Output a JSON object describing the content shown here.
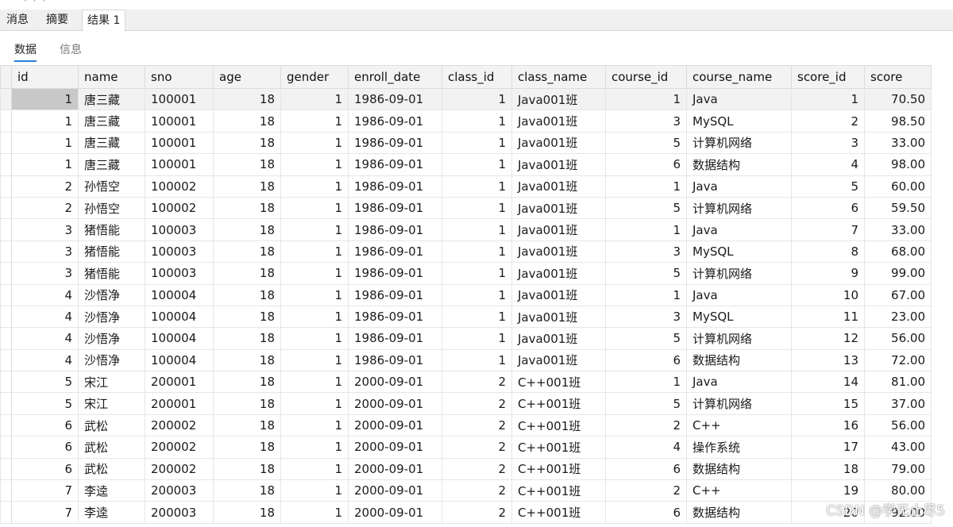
{
  "tabs": [
    "消息",
    "摘要",
    "结果 1"
  ],
  "subtabs": [
    "数据",
    "信息"
  ],
  "columns": [
    "id",
    "name",
    "sno",
    "age",
    "gender",
    "enroll_date",
    "class_id",
    "class_name",
    "course_id",
    "course_name",
    "score_id",
    "score"
  ],
  "rows": [
    [
      "1",
      "唐三藏",
      "100001",
      "18",
      "1",
      "1986-09-01",
      "1",
      "Java001班",
      "1",
      "Java",
      "1",
      "70.50"
    ],
    [
      "1",
      "唐三藏",
      "100001",
      "18",
      "1",
      "1986-09-01",
      "1",
      "Java001班",
      "3",
      "MySQL",
      "2",
      "98.50"
    ],
    [
      "1",
      "唐三藏",
      "100001",
      "18",
      "1",
      "1986-09-01",
      "1",
      "Java001班",
      "5",
      "计算机网络",
      "3",
      "33.00"
    ],
    [
      "1",
      "唐三藏",
      "100001",
      "18",
      "1",
      "1986-09-01",
      "1",
      "Java001班",
      "6",
      "数据结构",
      "4",
      "98.00"
    ],
    [
      "2",
      "孙悟空",
      "100002",
      "18",
      "1",
      "1986-09-01",
      "1",
      "Java001班",
      "1",
      "Java",
      "5",
      "60.00"
    ],
    [
      "2",
      "孙悟空",
      "100002",
      "18",
      "1",
      "1986-09-01",
      "1",
      "Java001班",
      "5",
      "计算机网络",
      "6",
      "59.50"
    ],
    [
      "3",
      "猪悟能",
      "100003",
      "18",
      "1",
      "1986-09-01",
      "1",
      "Java001班",
      "1",
      "Java",
      "7",
      "33.00"
    ],
    [
      "3",
      "猪悟能",
      "100003",
      "18",
      "1",
      "1986-09-01",
      "1",
      "Java001班",
      "3",
      "MySQL",
      "8",
      "68.00"
    ],
    [
      "3",
      "猪悟能",
      "100003",
      "18",
      "1",
      "1986-09-01",
      "1",
      "Java001班",
      "5",
      "计算机网络",
      "9",
      "99.00"
    ],
    [
      "4",
      "沙悟净",
      "100004",
      "18",
      "1",
      "1986-09-01",
      "1",
      "Java001班",
      "1",
      "Java",
      "10",
      "67.00"
    ],
    [
      "4",
      "沙悟净",
      "100004",
      "18",
      "1",
      "1986-09-01",
      "1",
      "Java001班",
      "3",
      "MySQL",
      "11",
      "23.00"
    ],
    [
      "4",
      "沙悟净",
      "100004",
      "18",
      "1",
      "1986-09-01",
      "1",
      "Java001班",
      "5",
      "计算机网络",
      "12",
      "56.00"
    ],
    [
      "4",
      "沙悟净",
      "100004",
      "18",
      "1",
      "1986-09-01",
      "1",
      "Java001班",
      "6",
      "数据结构",
      "13",
      "72.00"
    ],
    [
      "5",
      "宋江",
      "200001",
      "18",
      "1",
      "2000-09-01",
      "2",
      "C++001班",
      "1",
      "Java",
      "14",
      "81.00"
    ],
    [
      "5",
      "宋江",
      "200001",
      "18",
      "1",
      "2000-09-01",
      "2",
      "C++001班",
      "5",
      "计算机网络",
      "15",
      "37.00"
    ],
    [
      "6",
      "武松",
      "200002",
      "18",
      "1",
      "2000-09-01",
      "2",
      "C++001班",
      "2",
      "C++",
      "16",
      "56.00"
    ],
    [
      "6",
      "武松",
      "200002",
      "18",
      "1",
      "2000-09-01",
      "2",
      "C++001班",
      "4",
      "操作系统",
      "17",
      "43.00"
    ],
    [
      "6",
      "武松",
      "200002",
      "18",
      "1",
      "2000-09-01",
      "2",
      "C++001班",
      "6",
      "数据结构",
      "18",
      "79.00"
    ],
    [
      "7",
      "李逵",
      "200003",
      "18",
      "1",
      "2000-09-01",
      "2",
      "C++001班",
      "2",
      "C++",
      "19",
      "80.00"
    ],
    [
      "7",
      "李逵",
      "200003",
      "18",
      "1",
      "2000-09-01",
      "2",
      "C++001班",
      "6",
      "数据结构",
      "20",
      "92.00"
    ]
  ],
  "watermark": "CSDN @学无止尽5"
}
